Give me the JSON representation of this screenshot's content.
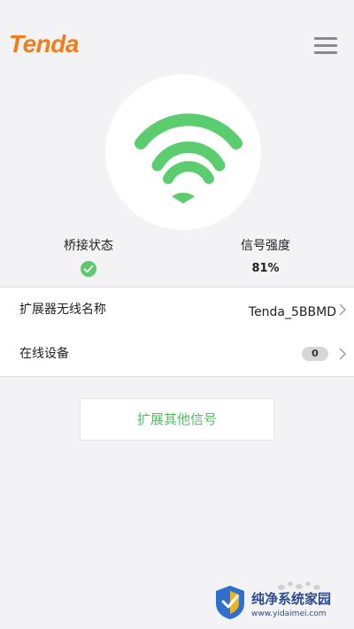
{
  "header": {
    "logo_text": "Tenda"
  },
  "status": {
    "bridge_label": "桥接状态",
    "bridge_ok": true,
    "signal_label": "信号强度",
    "signal_value": "81%"
  },
  "rows": {
    "ssid": {
      "label": "扩展器无线名称",
      "value": "Tenda_5BBMD"
    },
    "devices": {
      "label": "在线设备",
      "count": "0"
    }
  },
  "extend_button": {
    "label": "扩展其他信号"
  },
  "watermark": {
    "site_name": "纯净系统家园",
    "url": "www.yidaimei.com"
  },
  "colors": {
    "brand_orange": "#f07d1a",
    "wifi_green": "#5ccd6e",
    "accent_green": "#4fbf5f",
    "background": "#f3f3f5"
  }
}
